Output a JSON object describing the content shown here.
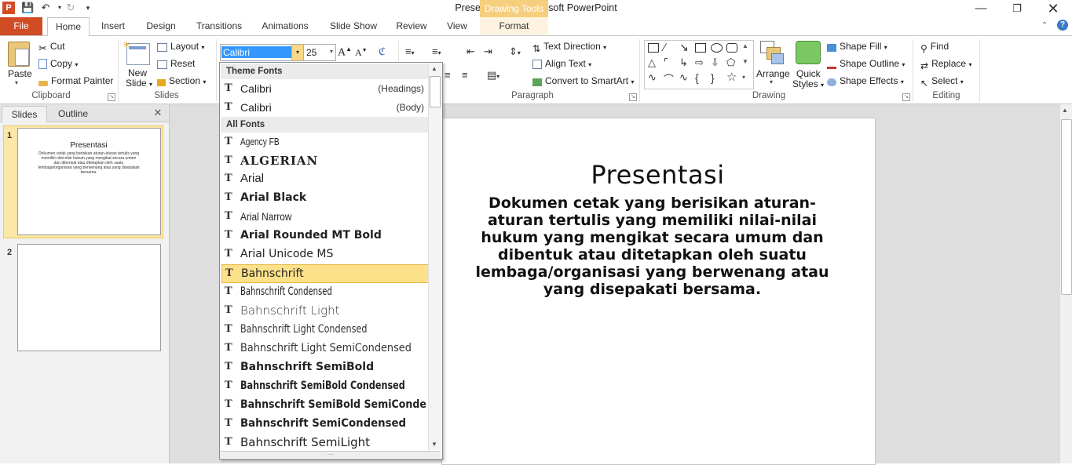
{
  "window": {
    "title": "Presentation2  -  Microsoft PowerPoint",
    "contextual_tab_group": "Drawing Tools"
  },
  "tabs": [
    "File",
    "Home",
    "Insert",
    "Design",
    "Transitions",
    "Animations",
    "Slide Show",
    "Review",
    "View",
    "Format"
  ],
  "ribbon": {
    "clipboard": {
      "label": "Clipboard",
      "paste": "Paste",
      "cut": "Cut",
      "copy": "Copy",
      "format_painter": "Format Painter"
    },
    "slides": {
      "label": "Slides",
      "new_slide_line1": "New",
      "new_slide_line2": "Slide",
      "layout": "Layout",
      "reset": "Reset",
      "section": "Section"
    },
    "font": {
      "name_value": "Calibri",
      "size_value": "25"
    },
    "paragraph": {
      "label": "Paragraph",
      "text_direction": "Text Direction",
      "align_text": "Align Text",
      "convert_smartart": "Convert to SmartArt"
    },
    "drawing": {
      "label": "Drawing",
      "arrange": "Arrange",
      "quick_styles_line1": "Quick",
      "quick_styles_line2": "Styles",
      "shape_fill": "Shape Fill",
      "shape_outline": "Shape Outline",
      "shape_effects": "Shape Effects"
    },
    "editing": {
      "label": "Editing",
      "find": "Find",
      "replace": "Replace",
      "select": "Select"
    }
  },
  "left_pane": {
    "tabs": [
      "Slides",
      "Outline"
    ],
    "thumbnails": [
      {
        "number": "1",
        "title": "Presentasi",
        "body": "Dokumen cetak yang berisikan aturan-aturan tertulis yang memiliki nilai-nilai hukum yang mengikat secara umum dan dibentuk atau ditetapkan oleh suatu lembaga/organisasi yang berwenang atau yang disepakati bersama."
      },
      {
        "number": "2",
        "title": "",
        "body": ""
      }
    ]
  },
  "slide": {
    "title": "Presentasi",
    "body_lines": [
      "Dokumen cetak yang berisikan aturan-",
      "aturan tertulis yang memiliki nilai-nilai",
      "hukum yang mengikat secara umum dan",
      "dibentuk atau ditetapkan oleh suatu",
      "lembaga/organisasi yang berwenang atau",
      "yang disepakati bersama."
    ]
  },
  "font_dropdown": {
    "theme_header": "Theme Fonts",
    "theme_fonts": [
      {
        "name": "Calibri",
        "tag": "(Headings)"
      },
      {
        "name": "Calibri",
        "tag": "(Body)"
      }
    ],
    "all_header": "All Fonts",
    "all_fonts": [
      "Agency FB",
      "ALGERIAN",
      "Arial",
      "Arial Black",
      "Arial Narrow",
      "Arial Rounded MT Bold",
      "Arial Unicode MS",
      "Bahnschrift",
      "Bahnschrift Condensed",
      "Bahnschrift Light",
      "Bahnschrift Light Condensed",
      "Bahnschrift Light SemiCondensed",
      "Bahnschrift SemiBold",
      "Bahnschrift SemiBold Condensed",
      "Bahnschrift SemiBold SemiConden",
      "Bahnschrift SemiCondensed",
      "Bahnschrift SemiLight"
    ],
    "highlighted": "Bahnschrift"
  },
  "colors": {
    "file_tab": "#d14b25",
    "contextual_tab": "#f6cf7e",
    "highlight": "#fde18a",
    "thumbnail_selected": "#fde7a8",
    "workspace": "#dedede"
  }
}
